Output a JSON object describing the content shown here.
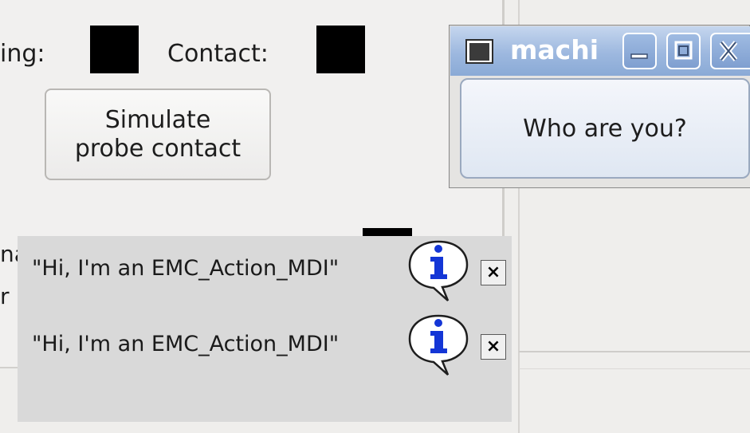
{
  "main": {
    "running_label_partial": "ing:",
    "contact_label": "Contact:",
    "simulate_button_line1": "Simulate",
    "simulate_button_line2": "probe contact",
    "cut_text_1": "na",
    "cut_text_2": "r"
  },
  "notifications": [
    {
      "text": "\"Hi, I'm an EMC_Action_MDI\"",
      "icon": "info-bubble-icon",
      "close": "×"
    },
    {
      "text": "\"Hi, I'm an EMC_Action_MDI\"",
      "icon": "info-bubble-icon",
      "close": "×"
    }
  ],
  "dialog": {
    "title": "machi",
    "button_label": "Who are you?"
  },
  "colors": {
    "titlebar": "#9db8df",
    "notify_bg": "#d9d9d9",
    "info_blue": "#1436d6"
  }
}
